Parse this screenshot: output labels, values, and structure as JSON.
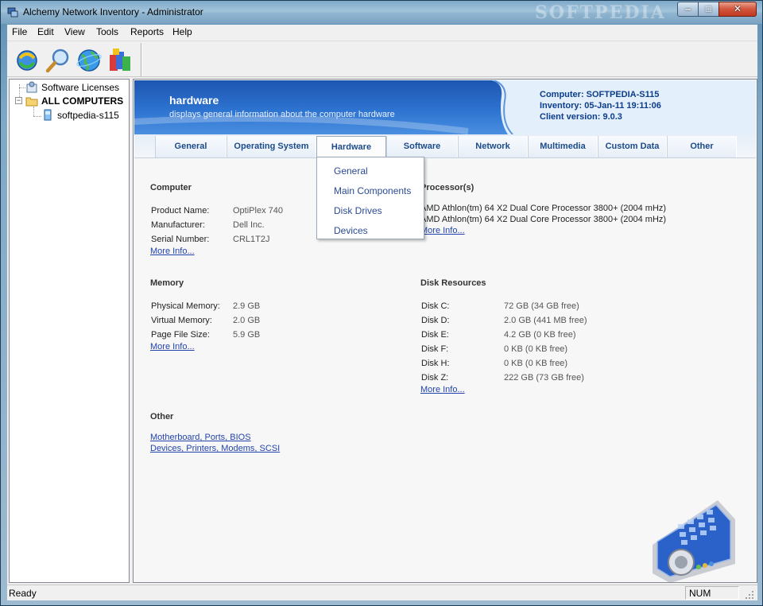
{
  "window": {
    "title": "Alchemy Network Inventory - Administrator",
    "watermark": "SOFTPEDIA",
    "controls": {
      "minimize": "‒",
      "maximize": "□",
      "close": "✕"
    }
  },
  "menubar": [
    "File",
    "Edit",
    "View",
    "Tools",
    "Reports",
    "Help"
  ],
  "toolbar": {
    "buttons": [
      "refresh-icon",
      "search-icon",
      "network-globe-icon",
      "install-package-icon"
    ]
  },
  "tree": {
    "items": [
      {
        "label": "Software Licenses",
        "icon": "licenses-icon"
      },
      {
        "label": "ALL COMPUTERS",
        "icon": "folder-icon",
        "expander": "−"
      },
      {
        "label": "softpedia-s115",
        "icon": "computer-icon"
      }
    ]
  },
  "banner": {
    "title": "hardware",
    "subtitle": "displays general information about the computer hardware",
    "computer": "Computer: SOFTPEDIA-S115",
    "inventory": "Inventory: 05-Jan-11 19:11:06",
    "client_version": "Client version: 9.0.3"
  },
  "tabs": [
    "General",
    "Operating System",
    "Hardware",
    "Software",
    "Network",
    "Multimedia",
    "Custom Data",
    "Other"
  ],
  "active_tab": "Hardware",
  "dropdown": [
    "General",
    "Main Components",
    "Disk Drives",
    "Devices"
  ],
  "computer": {
    "title": "Computer",
    "rows": [
      {
        "label": "Product Name:",
        "value": "OptiPlex 740"
      },
      {
        "label": "Manufacturer:",
        "value": "Dell Inc."
      },
      {
        "label": "Serial Number:",
        "value": "CRL1T2J"
      }
    ],
    "more": "More Info..."
  },
  "processor": {
    "title": "Processor(s)",
    "lines": [
      "AMD Athlon(tm) 64 X2 Dual Core Processor 3800+ (2004 mHz)",
      "AMD Athlon(tm) 64 X2 Dual Core Processor 3800+ (2004 mHz)"
    ],
    "more": "More Info..."
  },
  "memory": {
    "title": "Memory",
    "rows": [
      {
        "label": "Physical Memory:",
        "value": "2.9 GB"
      },
      {
        "label": "Virtual Memory:",
        "value": "2.0 GB"
      },
      {
        "label": "Page File Size:",
        "value": "5.9 GB"
      }
    ],
    "more": "More Info..."
  },
  "disks": {
    "title": "Disk Resources",
    "rows": [
      {
        "label": "Disk C:",
        "value": "72 GB (34 GB free)"
      },
      {
        "label": "Disk D:",
        "value": "2.0 GB (441 MB free)"
      },
      {
        "label": "Disk E:",
        "value": "4.2 GB (0 KB free)"
      },
      {
        "label": "Disk F:",
        "value": "0 KB (0 KB free)"
      },
      {
        "label": "Disk H:",
        "value": "0 KB (0 KB free)"
      },
      {
        "label": "Disk Z:",
        "value": "222 GB (73 GB free)"
      }
    ],
    "more": "More Info..."
  },
  "other": {
    "title": "Other",
    "links": [
      "Motherboard, Ports, BIOS",
      "Devices, Printers, Modems, SCSI"
    ]
  },
  "statusbar": {
    "status": "Ready",
    "num": "NUM"
  },
  "colors": {
    "accent": "#2d73d0",
    "link": "#2244aa",
    "banner_text": "#0b3d8a"
  }
}
